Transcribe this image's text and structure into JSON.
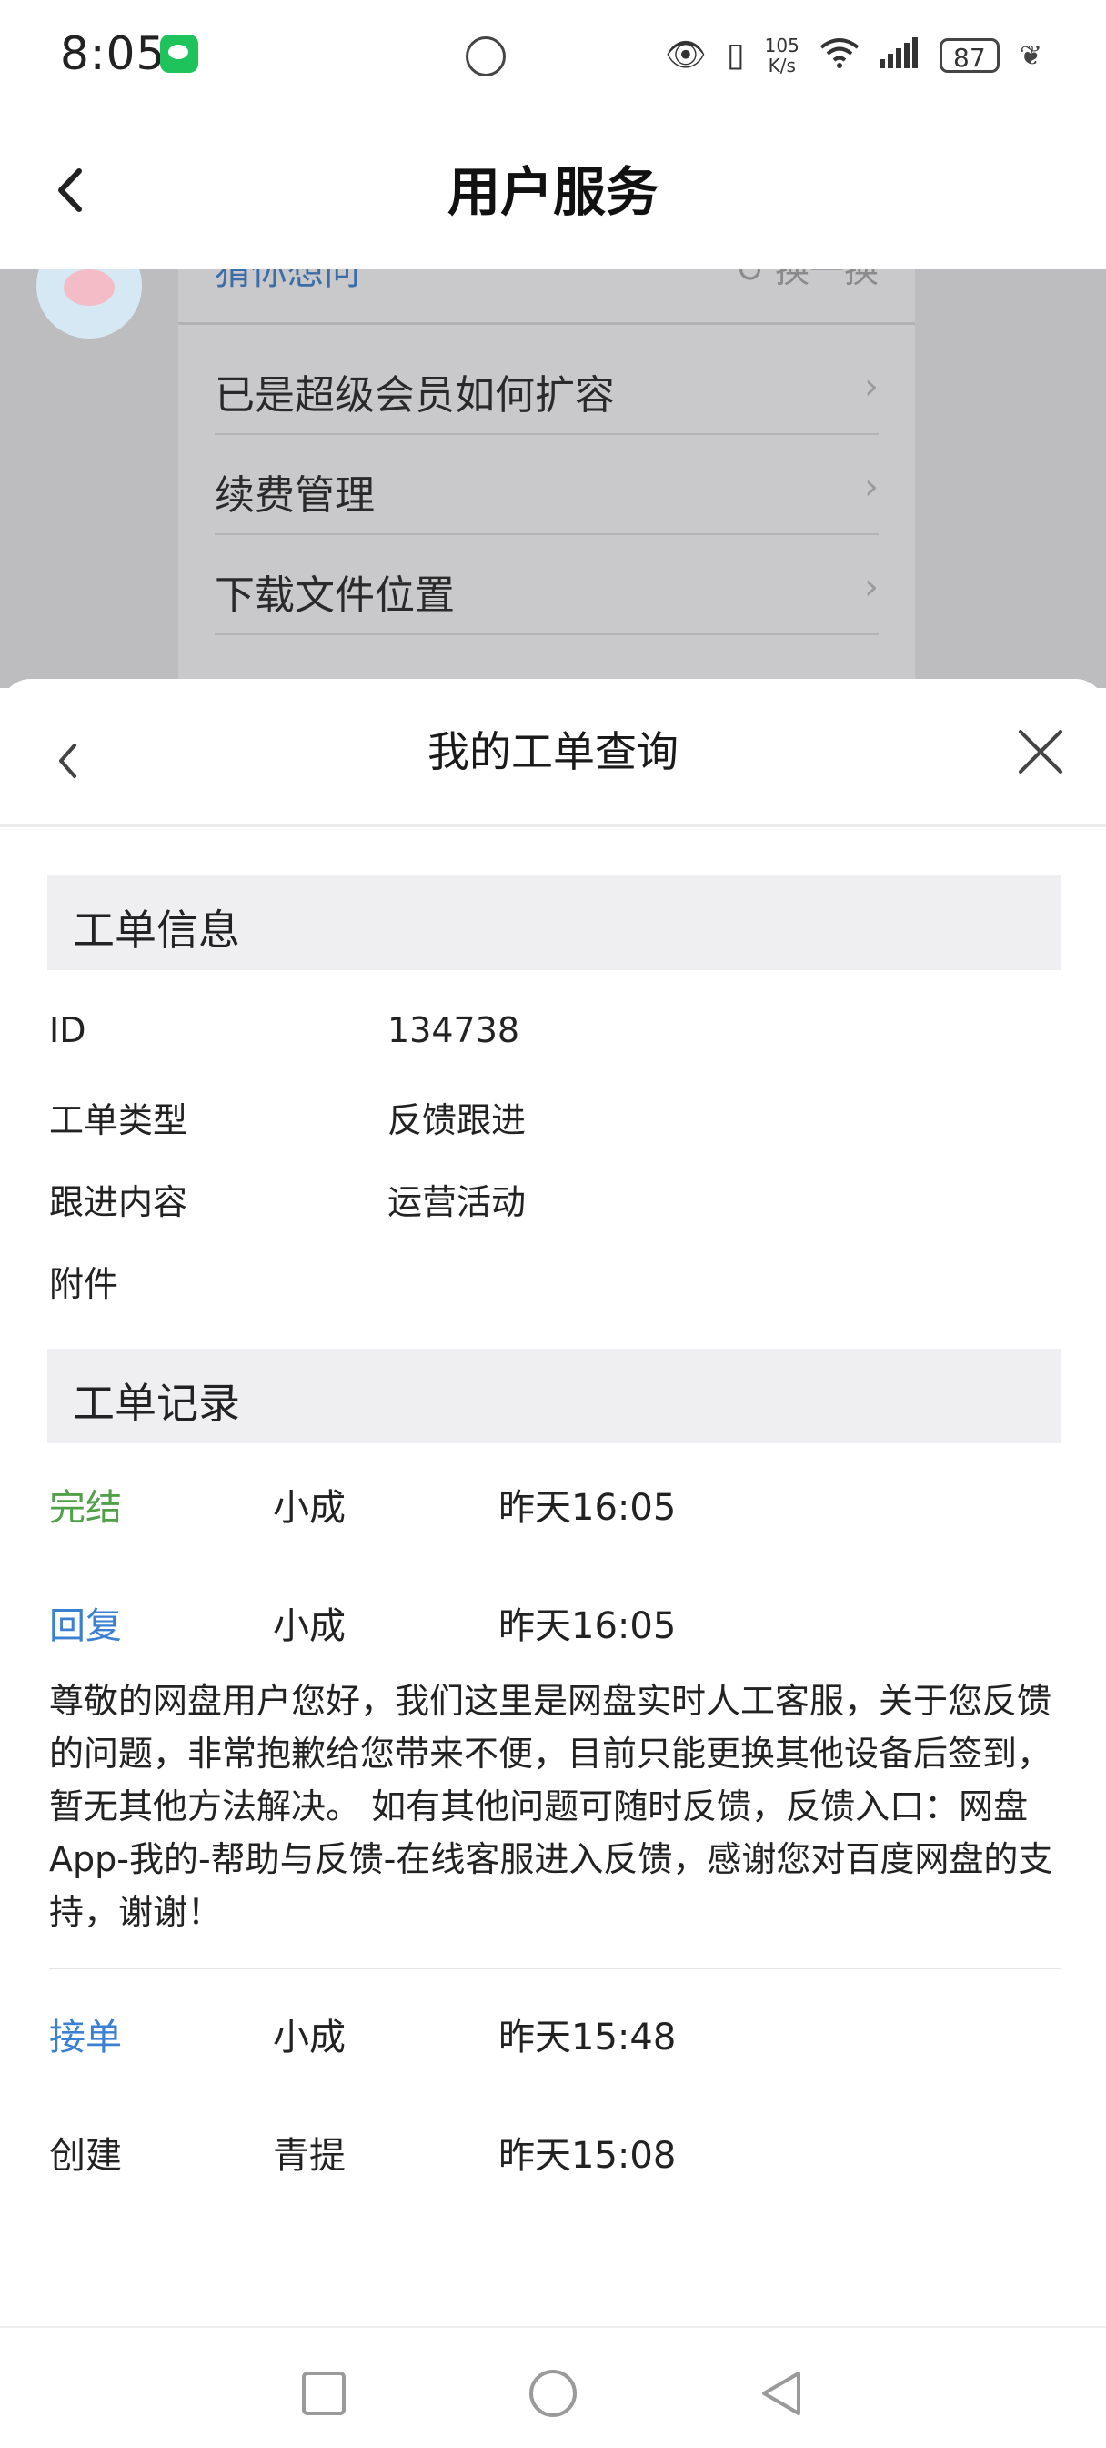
{
  "status_bar": {
    "time": "8:05",
    "speed_value": "105",
    "speed_unit": "K/s",
    "battery": "87",
    "icons": [
      "wechat-icon",
      "eye-icon",
      "vibrate-icon",
      "wifi-icon",
      "signal-icon",
      "battery-icon",
      "leaf-icon"
    ]
  },
  "header": {
    "title": "用户服务",
    "back_icon": "chevron-left-icon"
  },
  "background_card": {
    "heading": "猜你想问",
    "refresh_label": "换一换",
    "items": [
      {
        "label": "已是超级会员如何扩容"
      },
      {
        "label": "续费管理"
      },
      {
        "label": "下载文件位置"
      }
    ]
  },
  "sheet": {
    "title": "我的工单查询",
    "ticket_info": {
      "section_title": "工单信息",
      "rows": [
        {
          "key": "ID",
          "value": "134738"
        },
        {
          "key": "工单类型",
          "value": "反馈跟进"
        },
        {
          "key": "跟进内容",
          "value": "运营活动"
        },
        {
          "key": "附件",
          "value": ""
        }
      ]
    },
    "ticket_records": {
      "section_title": "工单记录",
      "records": [
        {
          "status": "完结",
          "person": "小成",
          "time": "昨天16:05",
          "status_color": "#4fa047"
        },
        {
          "status": "回复",
          "person": "小成",
          "time": "昨天16:05",
          "status_color": "#3a7fd0",
          "message": "尊敬的网盘用户您好，我们这里是网盘实时人工客服，关于您反馈的问题，非常抱歉给您带来不便，目前只能更换其他设备后签到，暂无其他方法解决。 如有其他问题可随时反馈，反馈入口：网盘App-我的-帮助与反馈-在线客服进入反馈，感谢您对百度网盘的支持，谢谢！"
        },
        {
          "status": "接单",
          "person": "小成",
          "time": "昨天15:48",
          "status_color": "#3a7fd0"
        },
        {
          "status": "创建",
          "person": "青提",
          "time": "昨天15:08",
          "status_color": "#222222"
        }
      ]
    }
  },
  "nav_bar": {
    "buttons": [
      "recents-square-icon",
      "home-circle-icon",
      "back-triangle-icon"
    ]
  }
}
